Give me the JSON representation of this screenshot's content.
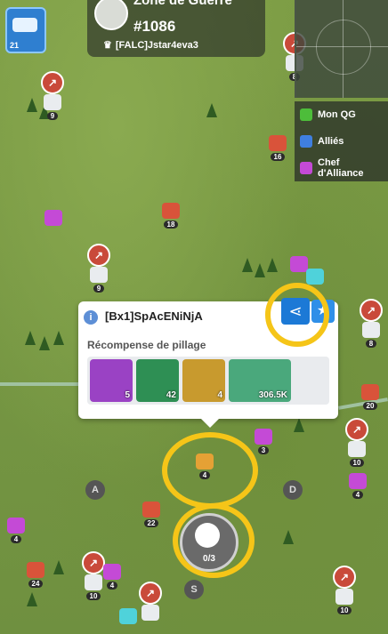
{
  "header": {
    "zone_title": "Zone de Guerre",
    "zone_id": "#1086",
    "owner": "[FALC]Jstar4eva3"
  },
  "tank_button": {
    "level": "21"
  },
  "legend": [
    {
      "label": "Mon QG",
      "color": "#4dbd3a"
    },
    {
      "label": "Alliés",
      "color": "#3f7fe0"
    },
    {
      "label": "Chef d'Alliance",
      "color": "#c44ad6"
    }
  ],
  "popup": {
    "player": "[Bx1]SpAcENiNjA",
    "reward_title": "Récompense de pillage",
    "rewards": [
      {
        "name": "purple-mystery-box",
        "count": "5"
      },
      {
        "name": "green-chest",
        "count": "42"
      },
      {
        "name": "gold-chest",
        "count": "4"
      },
      {
        "name": "resource-bundle",
        "count": "306.5K"
      }
    ]
  },
  "loot_button": {
    "progress": "0/3"
  },
  "directions": [
    "A",
    "D",
    "S"
  ],
  "map_levels": {
    "pin1": "9",
    "pin2": "8",
    "pin3": "9",
    "pin4": "16",
    "pin5": "18",
    "pin6": "8",
    "pin7": "3",
    "pin8": "20",
    "pin9": "10",
    "pin10": "4",
    "pin11": "22",
    "pin12": "4",
    "pin13": "24",
    "pin14": "10",
    "pin15": "4",
    "pin16": "10",
    "pin17": "4"
  }
}
